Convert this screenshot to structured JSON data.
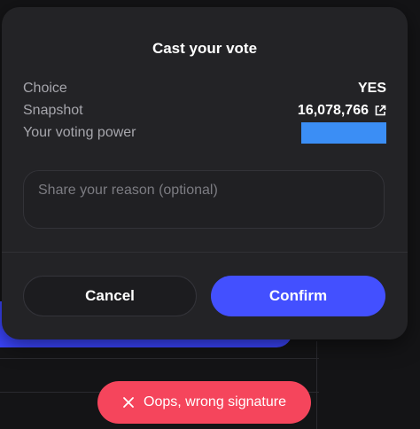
{
  "modal": {
    "title": "Cast your vote",
    "rows": [
      {
        "label": "Choice",
        "value": "YES"
      },
      {
        "label": "Snapshot",
        "value": "16,078,766"
      },
      {
        "label": "Your voting power",
        "value": ""
      }
    ],
    "reason_placeholder": "Share your reason (optional)",
    "cancel_label": "Cancel",
    "confirm_label": "Confirm"
  },
  "toast": {
    "message": "Oops, wrong signature",
    "icon": "close-icon"
  },
  "colors": {
    "accent": "#4350ff",
    "toast": "#f5455c",
    "voting_power_redaction": "#3b8ef5"
  }
}
